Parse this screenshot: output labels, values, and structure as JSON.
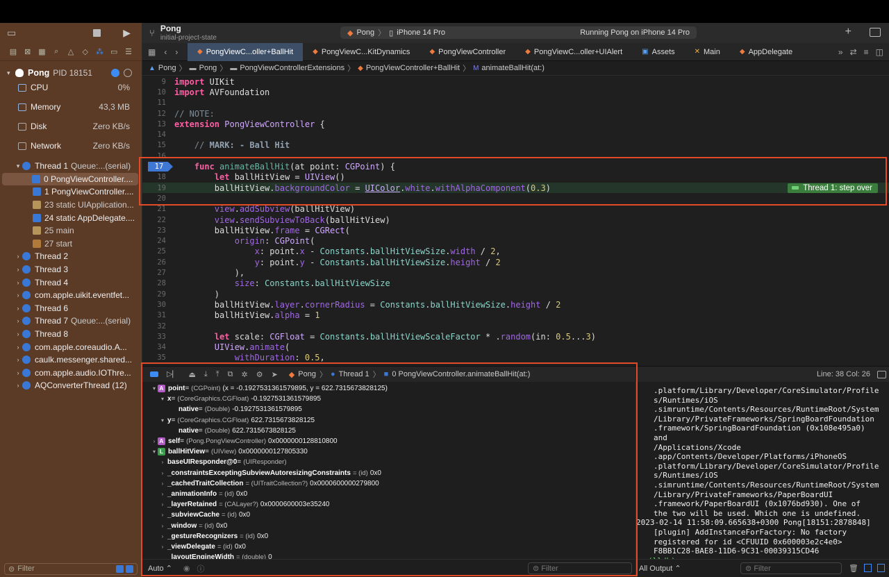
{
  "toolbar": {
    "project": "Pong",
    "branch": "initial-project-state",
    "scheme": "Pong",
    "device": "iPhone 14 Pro",
    "status": "Running Pong on iPhone 14 Pro"
  },
  "process": {
    "name": "Pong",
    "pid": "PID 18151"
  },
  "gauges": [
    {
      "label": "CPU",
      "value": "0%"
    },
    {
      "label": "Memory",
      "value": "43,3 MB"
    },
    {
      "label": "Disk",
      "value": "Zero KB/s"
    },
    {
      "label": "Network",
      "value": "Zero KB/s"
    }
  ],
  "threads": [
    {
      "label": "Thread 1",
      "sub": "Queue:...(serial)",
      "expanded": true
    },
    {
      "label": "0 PongViewController....",
      "frame": true,
      "selected": true
    },
    {
      "label": "1 PongViewController....",
      "frame": true
    },
    {
      "label": "23 static UIApplication...",
      "frame": true,
      "dim": true
    },
    {
      "label": "24 static AppDelegate....",
      "frame": true
    },
    {
      "label": "25 main",
      "frame": true,
      "dim": true
    },
    {
      "label": "27 start",
      "frame": true,
      "dim": true,
      "start": true
    },
    {
      "label": "Thread 2"
    },
    {
      "label": "Thread 3"
    },
    {
      "label": "Thread 4"
    },
    {
      "label": "com.apple.uikit.eventfet..."
    },
    {
      "label": "Thread 6"
    },
    {
      "label": "Thread 7",
      "sub": "Queue:...(serial)"
    },
    {
      "label": "Thread 8"
    },
    {
      "label": "com.apple.coreaudio.A..."
    },
    {
      "label": "caulk.messenger.shared..."
    },
    {
      "label": "com.apple.audio.IOThre..."
    },
    {
      "label": "AQConverterThread (12)"
    }
  ],
  "sidebar_filter": "Filter",
  "tabs": [
    {
      "label": "PongViewC...oller+BallHit",
      "active": true
    },
    {
      "label": "PongViewC...KitDynamics"
    },
    {
      "label": "PongViewController"
    },
    {
      "label": "PongViewC...oller+UIAlert"
    },
    {
      "label": "Assets"
    },
    {
      "label": "Main"
    },
    {
      "label": "AppDelegate"
    }
  ],
  "jumpbar": [
    "Pong",
    "Pong",
    "PongViewControllerExtensions",
    "PongViewController+BallHit",
    "animateBallHit(at:)"
  ],
  "editor": {
    "lines": [
      {
        "n": "9",
        "html": "<span class='kw'>import</span> UIKit"
      },
      {
        "n": "10",
        "html": "<span class='kw'>import</span> AVFoundation"
      },
      {
        "n": "11",
        "html": ""
      },
      {
        "n": "12",
        "html": "<span class='cm'>// NOTE:</span>"
      },
      {
        "n": "13",
        "html": "<span class='kw'>extension</span> <span class='ty'>PongViewController</span> {"
      },
      {
        "n": "14",
        "html": ""
      },
      {
        "n": "15",
        "html": "    <span class='cm'>// </span><span class='mk'>MARK: - Ball Hit</span>"
      },
      {
        "n": "16",
        "html": ""
      },
      {
        "n": "17",
        "html": "    <span class='kw'>func</span> <span class='fn'>animateBallHit</span>(at point: <span class='ty'>CGPoint</span>) {",
        "bp": true
      },
      {
        "n": "18",
        "html": "        <span class='kw'>let</span> ballHitView = <span class='ty'>UIView</span>()"
      },
      {
        "n": "19",
        "html": "        ballHitView.<span class='pr'>backgroundColor</span> = <span class='ty' style='text-decoration:underline'>UIColor</span>.<span class='pr'>white</span>.<span class='pr'>withAlphaComponent</span>(<span class='nm'>0.3</span>)",
        "current": true
      },
      {
        "n": "20",
        "html": ""
      },
      {
        "n": "21",
        "html": "        <span class='pr'>view</span>.<span class='pr'>addSubview</span>(ballHitView)"
      },
      {
        "n": "22",
        "html": "        <span class='pr'>view</span>.<span class='pr'>sendSubviewToBack</span>(ballHitView)"
      },
      {
        "n": "23",
        "html": "        ballHitView.<span class='pr'>frame</span> = <span class='ty'>CGRect</span>("
      },
      {
        "n": "24",
        "html": "            <span class='pr'>origin</span>: <span class='ty'>CGPoint</span>("
      },
      {
        "n": "25",
        "html": "                <span class='pr'>x</span>: point.<span class='pr'>x</span> - <span class='id'>Constants</span>.<span class='id'>ballHitViewSize</span>.<span class='pr'>width</span> / <span class='nm'>2</span>,"
      },
      {
        "n": "26",
        "html": "                <span class='pr'>y</span>: point.<span class='pr'>y</span> - <span class='id'>Constants</span>.<span class='id'>ballHitViewSize</span>.<span class='pr'>height</span> / <span class='nm'>2</span>"
      },
      {
        "n": "27",
        "html": "            ),"
      },
      {
        "n": "28",
        "html": "            <span class='pr'>size</span>: <span class='id'>Constants</span>.<span class='id'>ballHitViewSize</span>"
      },
      {
        "n": "29",
        "html": "        )"
      },
      {
        "n": "30",
        "html": "        ballHitView.<span class='pr'>layer</span>.<span class='pr'>cornerRadius</span> = <span class='id'>Constants</span>.<span class='id'>ballHitViewSize</span>.<span class='pr'>height</span> / <span class='nm'>2</span>"
      },
      {
        "n": "31",
        "html": "        ballHitView.<span class='pr'>alpha</span> = <span class='nm'>1</span>"
      },
      {
        "n": "32",
        "html": ""
      },
      {
        "n": "33",
        "html": "        <span class='kw'>let</span> scale: <span class='ty'>CGFloat</span> = <span class='id'>Constants</span>.<span class='id'>ballHitViewScaleFactor</span> * .<span class='pr'>random</span>(in: <span class='nm'>0.5</span>...<span class='nm'>3</span>)"
      },
      {
        "n": "34",
        "html": "        <span class='ty'>UIView</span>.<span class='pr'>animate</span>("
      },
      {
        "n": "35",
        "html": "            <span class='pr'>withDuration</span>: <span class='nm'>0.5</span>,"
      }
    ],
    "step_badge": "Thread 1: step over"
  },
  "debugbar": {
    "crumb": [
      "Pong",
      "Thread 1",
      "0 PongViewController.animateBallHit(at:)"
    ],
    "line_col": "Line: 38  Col: 26"
  },
  "variables": [
    {
      "indent": 0,
      "arrow": "▾",
      "badge": "A",
      "color": "#b45ac8",
      "name": "point",
      "type": "(CGPoint)",
      "value": "(x = -0.1927531361579895, y = 622.7315673828125)"
    },
    {
      "indent": 1,
      "arrow": "▾",
      "name": "x",
      "type": "(CoreGraphics.CGFloat)",
      "value": "-0.1927531361579895"
    },
    {
      "indent": 2,
      "arrow": "",
      "name": "native",
      "type": "(Double)",
      "value": "-0.1927531361579895"
    },
    {
      "indent": 1,
      "arrow": "▾",
      "name": "y",
      "type": "(CoreGraphics.CGFloat)",
      "value": "622.7315673828125"
    },
    {
      "indent": 2,
      "arrow": "",
      "name": "native",
      "type": "(Double)",
      "value": "622.7315673828125"
    },
    {
      "indent": 0,
      "arrow": "›",
      "badge": "A",
      "color": "#b45ac8",
      "name": "self",
      "type": "(Pong.PongViewController)",
      "value": "0x0000000128810800"
    },
    {
      "indent": 0,
      "arrow": "▾",
      "badge": "L",
      "color": "#3a9d4a",
      "name": "ballHitView",
      "type": "(UIView)",
      "value": "0x0000000127805330"
    },
    {
      "indent": 1,
      "arrow": "›",
      "name": "baseUIResponder@0",
      "type": "(UIResponder)",
      "value": ""
    },
    {
      "indent": 1,
      "arrow": "›",
      "name": "_constraintsExceptingSubviewAutoresizingConstraints",
      "type": "= (id)",
      "value": "0x0"
    },
    {
      "indent": 1,
      "arrow": "›",
      "name": "_cachedTraitCollection",
      "type": "= (UITraitCollection?)",
      "value": "0x0000600000279800"
    },
    {
      "indent": 1,
      "arrow": "›",
      "name": "_animationInfo",
      "type": "= (id)",
      "value": "0x0"
    },
    {
      "indent": 1,
      "arrow": "›",
      "name": "_layerRetained",
      "type": "= (CALayer?)",
      "value": "0x0000600003e35240"
    },
    {
      "indent": 1,
      "arrow": "›",
      "name": "_subviewCache",
      "type": "= (id)",
      "value": "0x0"
    },
    {
      "indent": 1,
      "arrow": "›",
      "name": "_window",
      "type": "= (id)",
      "value": "0x0"
    },
    {
      "indent": 1,
      "arrow": "›",
      "name": "_gestureRecognizers",
      "type": "= (id)",
      "value": "0x0"
    },
    {
      "indent": 1,
      "arrow": "›",
      "name": "_viewDelegate",
      "type": "= (id)",
      "value": "0x0"
    },
    {
      "indent": 1,
      "arrow": "",
      "name": "_layoutEngineWidth",
      "type": "= (double)",
      "value": "0"
    }
  ],
  "vars_bottom": {
    "mode": "Auto",
    "filter": "Filter"
  },
  "console": {
    "lines": [
      ".platform/Library/Developer/CoreSimulator/Profile",
      "s/Runtimes/iOS",
      ".simruntime/Contents/Resources/RuntimeRoot/System",
      "/Library/PrivateFrameworks/SpringBoardFoundation",
      ".framework/SpringBoardFoundation (0x108e495a0)",
      "and",
      "/Applications/Xcode",
      ".app/Contents/Developer/Platforms/iPhoneOS",
      ".platform/Library/Developer/CoreSimulator/Profile",
      "s/Runtimes/iOS",
      ".simruntime/Contents/Resources/RuntimeRoot/System",
      "/Library/PrivateFrameworks/PaperBoardUI",
      ".framework/PaperBoardUI (0x1076bd930). One of",
      "the two will be used. Which one is undefined."
    ],
    "timestamp_line": "2023-02-14 11:58:09.665638+0300 Pong[18151:2878848]",
    "tail": [
      "[plugin] AddInstanceForFactory: No factory",
      "registered for id <CFUUID 0x600003e2c4e0>",
      "F8BB1C28-BAE8-11D6-9C31-00039315CD46"
    ],
    "prompt": "(lldb)",
    "output_mode": "All Output",
    "filter": "Filter"
  },
  "colors": {
    "highlight": "#e24a28",
    "accent": "#3d8cf5",
    "sidebar": "#5b3a26"
  }
}
